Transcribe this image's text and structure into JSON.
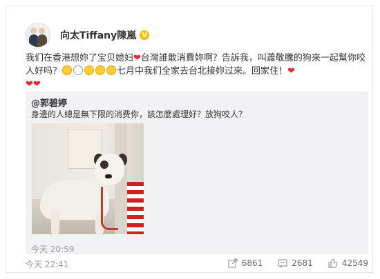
{
  "author": {
    "name": "向太Tiffany陳嵐",
    "verified_badge": "V"
  },
  "post": {
    "text_part1": "我们在香港想妳了宝贝媳妇",
    "text_part2": "台灣誰敢消費妳啊？告訴我，叫蕭敬騰的狗來一起幫你咬人好吗？",
    "text_part3": "七月中我们全家去台北接妳过來。回家住！",
    "time": "今天 22:41"
  },
  "repost": {
    "user": "@郭碧婷",
    "text": "身邊的人總是無下限的消费你，該怎麼處理好？放狗咬人？",
    "time": "今天 20:59"
  },
  "actions": {
    "forward_count": "6861",
    "comment_count": "2681",
    "like_count": "42549"
  },
  "colors": {
    "heart": "#e8272c",
    "badge": "#ffbf00",
    "repost_bg": "#f2f2f5"
  }
}
